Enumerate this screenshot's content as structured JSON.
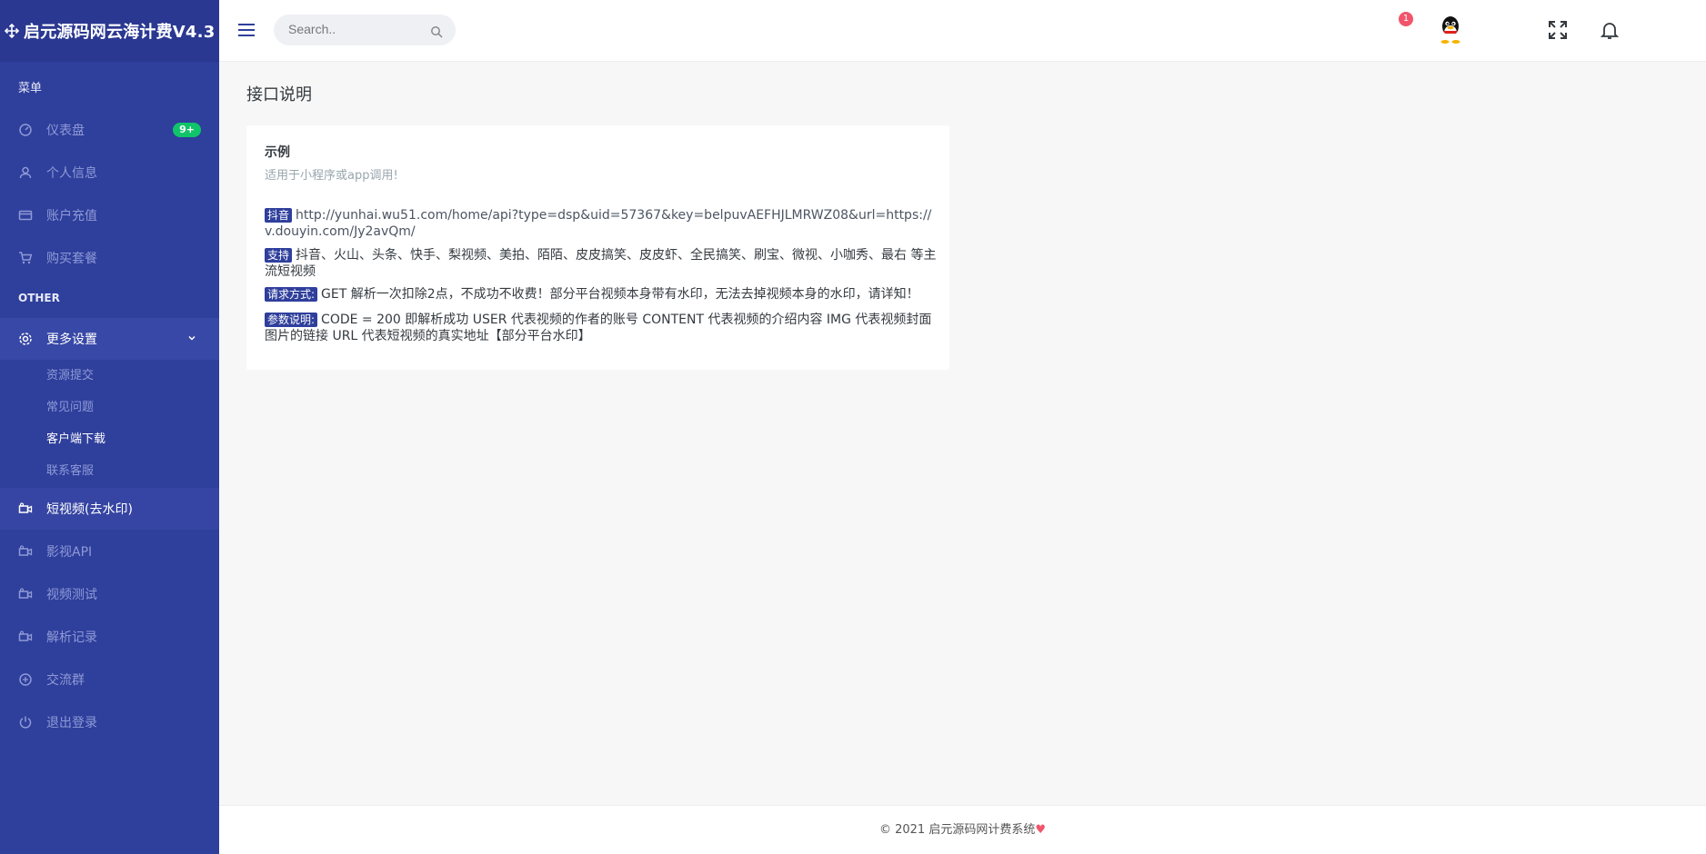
{
  "sidebar": {
    "brand": "启元源码网云海计费V4.3",
    "menu_title": "菜单",
    "other_title": "OTHER",
    "items": [
      {
        "label": "仪表盘",
        "badge": "9+"
      },
      {
        "label": "个人信息"
      },
      {
        "label": "账户充值"
      },
      {
        "label": "购买套餐"
      }
    ],
    "more_settings": {
      "label": "更多设置",
      "children": [
        "资源提交",
        "常见问题",
        "客户端下载",
        "联系客服"
      ]
    },
    "items2": [
      {
        "label": "短视频(去水印)"
      },
      {
        "label": "影视API"
      },
      {
        "label": "视频测试"
      },
      {
        "label": "解析记录"
      },
      {
        "label": "交流群"
      },
      {
        "label": "退出登录"
      }
    ]
  },
  "topbar": {
    "search_placeholder": "Search..",
    "notification_count": "1"
  },
  "main": {
    "page_title": "接口说明",
    "card": {
      "title": "示例",
      "subtitle": "适用于小程序或app调用!",
      "rows": [
        {
          "tag": "抖音",
          "text": "http://yunhai.wu51.com/home/api?type=dsp&uid=57367&key=belpuvAEFHJLMRWZ08&url=https://v.douyin.com/Jy2avQm/"
        },
        {
          "tag": "支持",
          "text": "抖音、火山、头条、快手、梨视频、美拍、陌陌、皮皮搞笑、皮皮虾、全民搞笑、刷宝、微视、小咖秀、最右 等主流短视频"
        },
        {
          "tag": "请求方式:",
          "text": "GET 解析一次扣除2点，不成功不收费！部分平台视频本身带有水印，无法去掉视频本身的水印，请详知！"
        },
        {
          "tag": "参数说明:",
          "text": "CODE = 200 即解析成功 USER 代表视频的作者的账号 CONTENT 代表视频的介绍内容 IMG 代表视频封面图片的链接 URL 代表短视频的真实地址【部分平台水印】"
        }
      ]
    }
  },
  "footer": {
    "text": "© 2021 启元源码网计费系统"
  },
  "colors": {
    "sidebar_bg": "#2f3f9c",
    "badge_green": "#10c469",
    "badge_red": "#f1556c"
  }
}
